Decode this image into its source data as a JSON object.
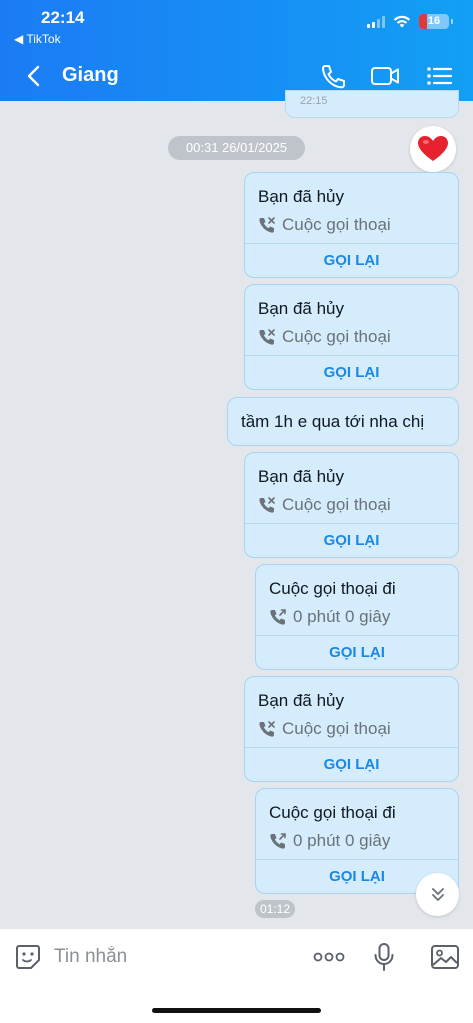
{
  "status_bar": {
    "time": "22:14",
    "back_app": "◀ TikTok",
    "battery": "16"
  },
  "header": {
    "title": "Giang",
    "icons": [
      "back-icon",
      "phone-icon",
      "video-icon",
      "menu-icon"
    ]
  },
  "chat": {
    "previous_time": "22:15",
    "date_separator": "00:31 26/01/2025",
    "reaction": "heart",
    "messages": [
      {
        "type": "call",
        "title": "Bạn đã hủy",
        "subtitle": "Cuộc gọi thoại",
        "button": "GỌI LẠI",
        "icon": "missed-call-icon"
      },
      {
        "type": "call",
        "title": "Bạn đã hủy",
        "subtitle": "Cuộc gọi thoại",
        "button": "GỌI LẠI",
        "icon": "missed-call-icon"
      },
      {
        "type": "text",
        "text": "tầm 1h e qua tới nha chị"
      },
      {
        "type": "call",
        "title": "Bạn đã hủy",
        "subtitle": "Cuộc gọi thoại",
        "button": "GỌI LẠI",
        "icon": "missed-call-icon"
      },
      {
        "type": "call",
        "title": "Cuộc gọi thoại đi",
        "subtitle": "0 phút 0 giây",
        "button": "GỌI LẠI",
        "icon": "outgoing-call-icon"
      },
      {
        "type": "call",
        "title": "Bạn đã hủy",
        "subtitle": "Cuộc gọi thoại",
        "button": "GỌI LẠI",
        "icon": "missed-call-icon"
      },
      {
        "type": "call",
        "title": "Cuộc gọi thoại đi",
        "subtitle": "0 phút 0 giây",
        "button": "GỌI LẠI",
        "icon": "outgoing-call-icon"
      }
    ],
    "last_time": "01:12"
  },
  "input": {
    "placeholder": "Tin nhắn"
  },
  "colors": {
    "header_start": "#1b7bf4",
    "header_end": "#139ff5",
    "bubble": "#d4ecfc",
    "accent": "#1a88e6"
  }
}
